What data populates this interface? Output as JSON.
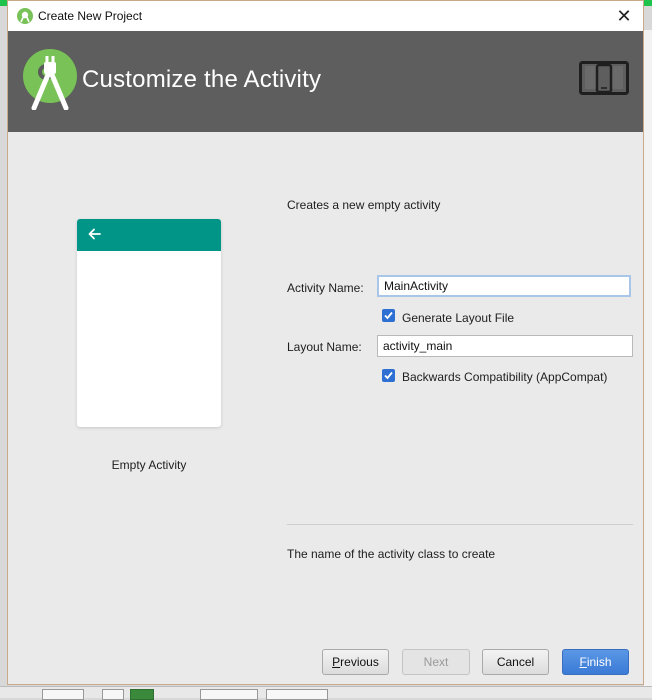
{
  "window": {
    "title": "Create New Project"
  },
  "header": {
    "title": "Customize the Activity"
  },
  "template": {
    "label": "Empty Activity"
  },
  "form": {
    "description": "Creates a new empty activity",
    "activity_name_label": "Activity Name:",
    "activity_name_value": "MainActivity",
    "generate_layout_label": "Generate Layout File",
    "generate_layout_checked": true,
    "layout_name_label": "Layout Name:",
    "layout_name_value": "activity_main",
    "backwards_compat_label": "Backwards Compatibility (AppCompat)",
    "backwards_compat_checked": true,
    "hint": "The name of the activity class to create"
  },
  "buttons": {
    "previous_mnemonic": "P",
    "previous_rest": "revious",
    "next": "Next",
    "cancel": "Cancel",
    "finish_mnemonic": "F",
    "finish_rest": "inish"
  },
  "colors": {
    "header_bg": "#5e5e5e",
    "toolbar_teal": "#019587",
    "checkbox_blue": "#2d6fd2",
    "finish_blue": "#3b7ad6",
    "android_green": "#78c257"
  },
  "icons": {
    "app": "android-studio-icon",
    "logo": "android-studio-logo",
    "device": "phone-tablet-icon",
    "back": "back-arrow-icon",
    "close": "close-icon"
  }
}
